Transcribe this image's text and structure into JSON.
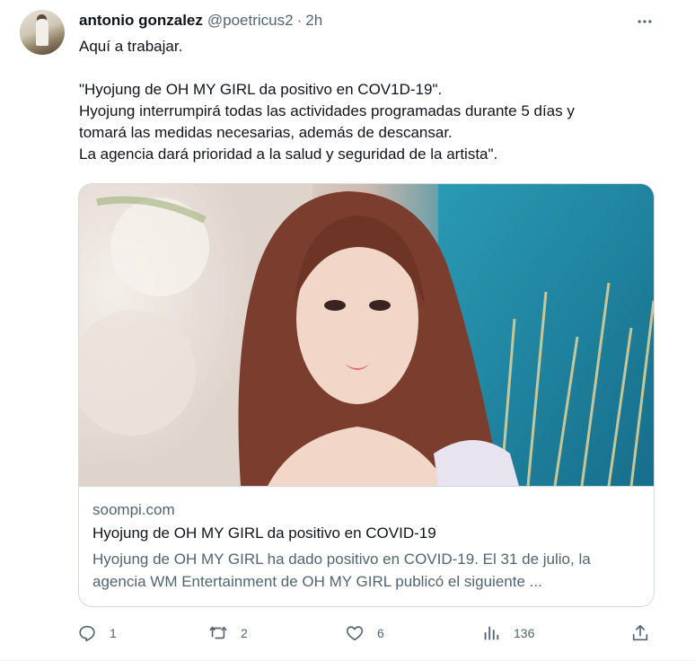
{
  "tweet": {
    "author_name": "antonio gonzalez",
    "handle": "@poetricus2",
    "separator": "·",
    "time": "2h",
    "text_lines": [
      "Aquí a trabajar.",
      "",
      "\"Hyojung de OH MY GIRL da positivo en COV1D-19\".",
      "Hyojung interrumpirá todas las actividades programadas durante 5 días y",
      "tomará las medidas necesarias, además de descansar.",
      "La agencia dará prioridad a la salud y seguridad de la artista\"."
    ]
  },
  "card": {
    "domain": "soompi.com",
    "title": "Hyojung de OH MY GIRL da positivo en COVID-19",
    "description": "Hyojung de OH MY GIRL ha dado positivo en COVID-19. El 31 de julio, la agencia WM Entertainment de OH MY GIRL publicó el siguiente ...",
    "image_icon": "photo-woman-portrait"
  },
  "actions": {
    "reply": {
      "icon": "reply-icon",
      "count": "1"
    },
    "retweet": {
      "icon": "retweet-icon",
      "count": "2"
    },
    "like": {
      "icon": "heart-icon",
      "count": "6"
    },
    "views": {
      "icon": "views-icon",
      "count": "136"
    },
    "share": {
      "icon": "share-icon"
    }
  },
  "colors": {
    "text_primary": "#0f1419",
    "text_secondary": "#536471",
    "border": "#cfd9de"
  }
}
